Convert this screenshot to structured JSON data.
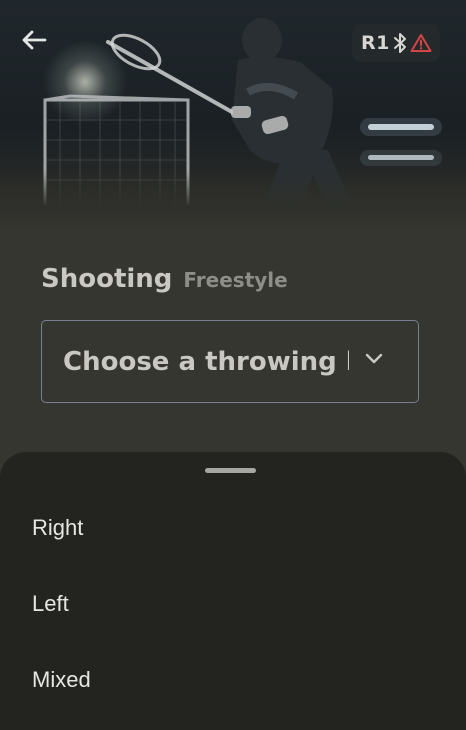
{
  "header": {
    "back_icon": "arrow-left-icon",
    "robot_id": "R1",
    "status_icons": [
      "bluetooth-icon",
      "warning-triangle-icon"
    ],
    "warning_color": "#d64545"
  },
  "hero": {
    "image": "lacrosse player shooting at goal in dim indoor gym"
  },
  "drill": {
    "title": "Shooting",
    "mode": "Freestyle"
  },
  "throwing_hand_select": {
    "value": "Choose a throwing hand",
    "chevron_icon": "chevron-down-icon",
    "border_color": "#7a7f93"
  },
  "bottom_sheet": {
    "options": [
      {
        "label": "Right"
      },
      {
        "label": "Left"
      },
      {
        "label": "Mixed"
      }
    ]
  },
  "colors": {
    "background": "#353630",
    "sheet": "#23241f",
    "text_primary": "#c9c8c2",
    "text_secondary": "#8e8e88"
  }
}
